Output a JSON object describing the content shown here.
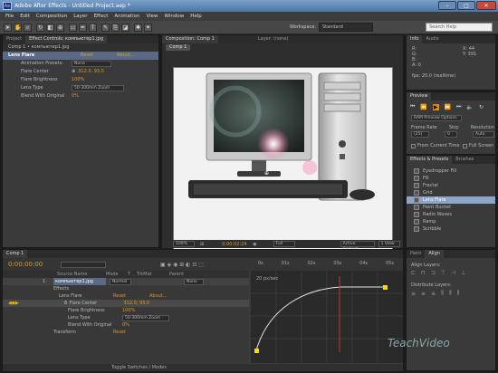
{
  "window": {
    "title": "Adobe After Effects - Untitled Project.aep *",
    "app_icon": "Ae"
  },
  "menu": [
    "File",
    "Edit",
    "Composition",
    "Layer",
    "Effect",
    "Animation",
    "View",
    "Window",
    "Help"
  ],
  "toolbar": {
    "tools": [
      "selection-tool",
      "hand-tool",
      "zoom-tool",
      "rotate-tool",
      "camera-tool",
      "pan-behind-tool",
      "pen-tool",
      "type-tool",
      "brush-tool",
      "clone-tool",
      "eraser-tool",
      "roto-tool",
      "puppet-tool"
    ],
    "workspace_label": "Workspace:",
    "workspace_value": "Standard",
    "search_placeholder": "Search Help"
  },
  "effect_controls": {
    "tabs": [
      "Project",
      "Effect Controls: компьютер1.jpg"
    ],
    "header": "Comp 1 • компьютер1.jpg",
    "effect_name": "Lens Flare",
    "reset": "Reset",
    "about": "About...",
    "animation_presets_label": "Animation Presets:",
    "animation_presets_value": "None",
    "props": [
      {
        "label": "Flare Center",
        "value": "312.0, 93.0"
      },
      {
        "label": "Flare Brightness",
        "value": "100%"
      },
      {
        "label": "Lens Type",
        "value": "50-300mm Zoom"
      },
      {
        "label": "Blend With Original",
        "value": "0%"
      }
    ]
  },
  "composition": {
    "tabs": [
      "Composition: Comp 1",
      "Layer: (none)"
    ],
    "sub_tab": "Comp 1",
    "zoom": "100%",
    "timecode": "0:00:02:24",
    "quality": "Full",
    "camera": "Active Camera",
    "views": "1 View"
  },
  "info": {
    "tabs": [
      "Info",
      "Audio"
    ],
    "rgb": [
      "R:",
      "G:",
      "B:",
      "A: 0"
    ],
    "coords": [
      "X: 44",
      "Y: 391"
    ],
    "fps": "fps: 20.0 (realtime)"
  },
  "preview": {
    "title": "Preview",
    "ram_options": "RAM Preview Options",
    "frame_rate_label": "Frame Rate",
    "skip_label": "Skip",
    "resolution_label": "Resolution",
    "frame_rate": "(25)",
    "skip": "0",
    "resolution": "Auto",
    "from_current": "From Current Time",
    "full_screen": "Full Screen"
  },
  "effects_presets": {
    "tabs": [
      "Effects & Presets",
      "Brushes"
    ],
    "items": [
      "Eyedropper Fill",
      "Fill",
      "Fractal",
      "Grid",
      "Lens Flare",
      "Paint Bucket",
      "Radio Waves",
      "Ramp",
      "Scribble"
    ],
    "selected": "Lens Flare"
  },
  "timeline": {
    "tab": "Comp 1",
    "timecode": "0:00:00:00",
    "columns": [
      "Source Name",
      "Mode",
      "T",
      "TrkMat",
      "Parent"
    ],
    "layer_num": "1",
    "layer_name": "компьютер1.jpg",
    "layer_mode": "Normal",
    "parent": "None",
    "rows": [
      {
        "label": "Effects",
        "value": ""
      },
      {
        "label": "Lens Flare",
        "value": "Reset"
      },
      {
        "label": "Flare Center",
        "value": "312.0, 93.0"
      },
      {
        "label": "Flare Brightness",
        "value": "100%"
      },
      {
        "label": "Lens Type",
        "value": "50-300mm Zoom"
      },
      {
        "label": "Blend With Original",
        "value": "0%"
      },
      {
        "label": "Transform",
        "value": "Reset"
      }
    ],
    "about": "About...",
    "ruler": [
      "0s",
      "01s",
      "02s",
      "03s",
      "04s",
      "05s"
    ],
    "graph_label": "20 px/sec",
    "footer": "Toggle Switches / Modes"
  },
  "align": {
    "tabs": [
      "Paint",
      "Align"
    ],
    "align_label": "Align Layers:",
    "distribute_label": "Distribute Layers:"
  },
  "watermark": "TeachVideo"
}
